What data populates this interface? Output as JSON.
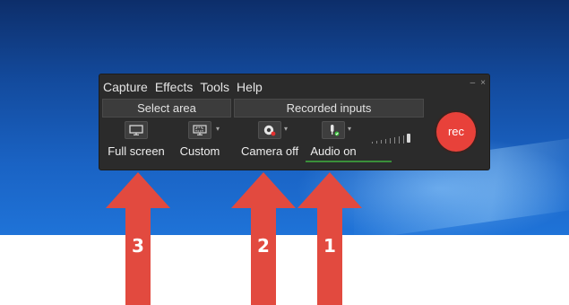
{
  "menu": {
    "capture": "Capture",
    "effects": "Effects",
    "tools": "Tools",
    "help": "Help",
    "minimize": "–",
    "close": "×"
  },
  "select_area": {
    "header": "Select area",
    "full_screen": "Full screen",
    "custom": "Custom"
  },
  "recorded_inputs": {
    "header": "Recorded inputs",
    "camera": "Camera off",
    "audio": "Audio on"
  },
  "rec": {
    "label": "rec",
    "color": "#e8413a"
  },
  "arrows": [
    {
      "number": "3",
      "points_to": "select-area"
    },
    {
      "number": "2",
      "points_to": "camera"
    },
    {
      "number": "1",
      "points_to": "audio"
    }
  ],
  "colors": {
    "arrow": "#e24a3f",
    "audio_on": "#3ac13a",
    "camera_off": "#e33030"
  },
  "icons": [
    "monitor-icon",
    "custom-region-icon",
    "webcam-icon",
    "microphone-icon"
  ]
}
